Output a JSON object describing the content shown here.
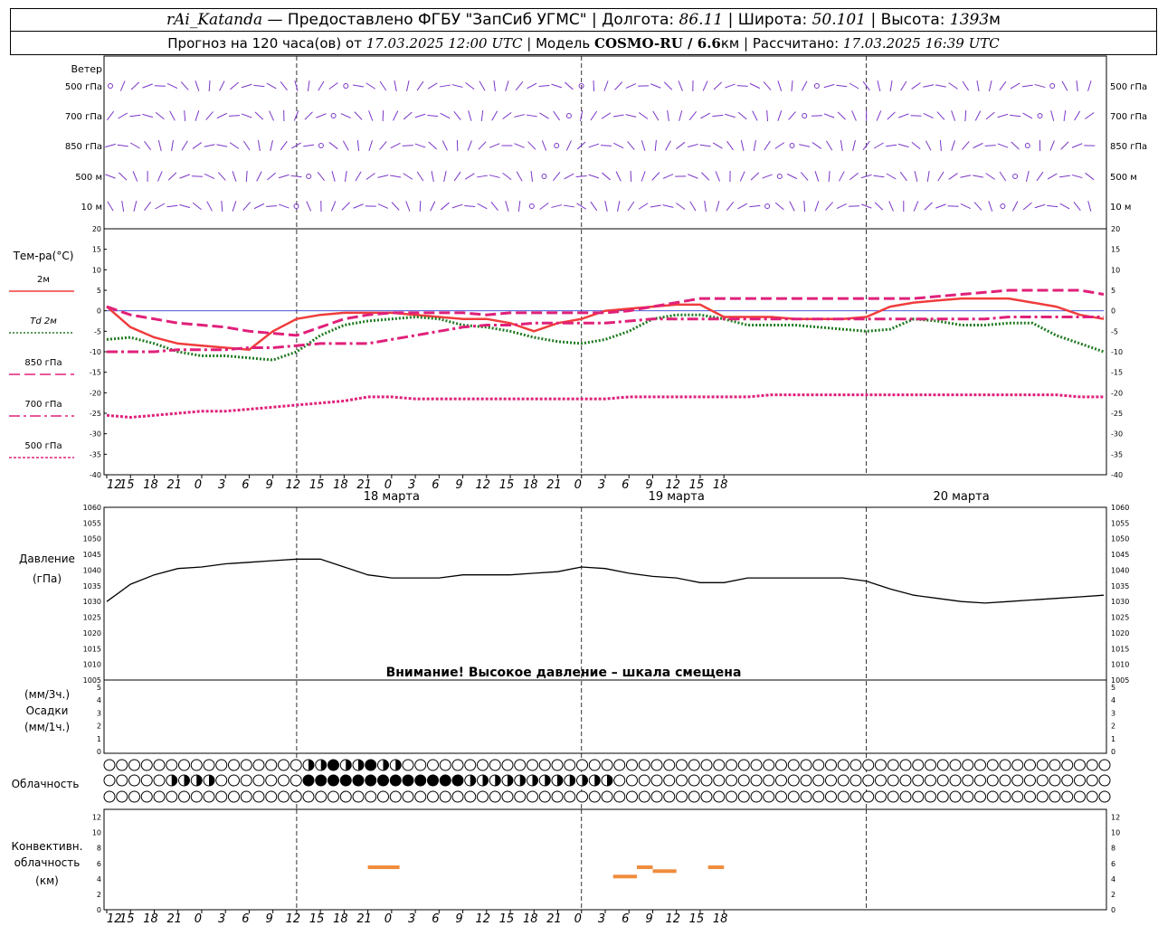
{
  "header": {
    "station": "rAi_Katanda",
    "provider": " — Предоставлено ФГБУ \"ЗапСиб УГМС\"  |  Долгота: ",
    "lon": "86.11",
    "lat_label": "  |  Широта: ",
    "lat": "50.101",
    "alt_label": "  |  Высота: ",
    "alt": "1393",
    "alt_unit": "м",
    "forecast_label": "Прогноз на 120 часа(ов) от ",
    "forecast_date": "17.03.2025 12:00 UTC",
    "model_label": "  |  Модель ",
    "model_name": "COSMO-RU / 6.6",
    "model_unit": "км",
    "calc_label": "  |  Рассчитано: ",
    "calc_date": "17.03.2025 16:39 UTC"
  },
  "wind_panel": {
    "title": "Ветер",
    "levels": [
      "500 гПа",
      "700 гПа",
      "850 гПа",
      "500 м",
      "10  м"
    ]
  },
  "temp_panel": {
    "title": "Тем-ра(°C)",
    "legend": [
      {
        "label": "2м",
        "color": "#f03c3c"
      },
      {
        "label": "Td  2м",
        "color": "#207a20"
      },
      {
        "label": "850 гПа",
        "color": "#e0207a"
      },
      {
        "label": "700 гПа",
        "color": "#e0207a"
      },
      {
        "label": "500 гПа",
        "color": "#e0207a"
      }
    ]
  },
  "pressure_panel": {
    "title_1": "Давление",
    "title_2": "(гПа)",
    "warning": "Внимание! Высокое давление – шкала смещена"
  },
  "precip_panel": {
    "label_1": "(мм/3ч.)",
    "label_2": "Осадки",
    "label_3": "(мм/1ч.)"
  },
  "cloud_panel": {
    "title": "Облачность"
  },
  "conv_panel": {
    "label_1": "Конвективн.",
    "label_2": "облачность",
    "label_3": "(км)"
  },
  "time_axis": {
    "hour_labels": [
      "12",
      "15",
      "18",
      "21",
      "0",
      "3",
      "6",
      "9",
      "12",
      "15",
      "18",
      "21",
      "0",
      "3",
      "6",
      "9",
      "12",
      "15",
      "18",
      "21",
      "0",
      "3",
      "6",
      "9",
      "12",
      "15",
      "18"
    ],
    "date_labels": [
      "18 марта",
      "19 марта",
      "20 марта"
    ]
  },
  "chart_data": [
    {
      "type": "line",
      "title": "Тем-ра(°C)",
      "x_hours": [
        0,
        3,
        6,
        9,
        12,
        15,
        18,
        21,
        24,
        27,
        30,
        33,
        36,
        39,
        42,
        45,
        48,
        51,
        54,
        57,
        60,
        63,
        66,
        69,
        72,
        75,
        78,
        81,
        84,
        87,
        90,
        93,
        96,
        99,
        102,
        105,
        108,
        111,
        114,
        117,
        120,
        123,
        126
      ],
      "ylim": [
        -40,
        20
      ],
      "series": [
        {
          "name": "2м",
          "color": "#f03c3c",
          "style": "solid",
          "values": [
            1,
            -4,
            -6.5,
            -8,
            -8.5,
            -9,
            -9.5,
            -5,
            -2,
            -1,
            -0.5,
            -0.5,
            -0.5,
            -1,
            -1.5,
            -2,
            -2,
            -3,
            -5,
            -3,
            -2,
            0,
            0.5,
            1,
            1.5,
            1.5,
            -1.5,
            -1.5,
            -1.5,
            -2,
            -2,
            -2,
            -1.5,
            1,
            2,
            2.5,
            3,
            3,
            3,
            2,
            1,
            -1,
            -2
          ]
        },
        {
          "name": "Td  2м",
          "color": "#207a20",
          "style": "dot",
          "values": [
            -7,
            -6.5,
            -8,
            -10,
            -11,
            -11,
            -11.5,
            -12,
            -10,
            -6,
            -3.5,
            -2.5,
            -2,
            -1.5,
            -2,
            -3.5,
            -4,
            -5,
            -6.5,
            -7.5,
            -8,
            -7,
            -5,
            -2,
            -1,
            -1,
            -2,
            -3.5,
            -3.5,
            -3.5,
            -4,
            -4.5,
            -5,
            -4.5,
            -2,
            -2.5,
            -3.5,
            -3.5,
            -3,
            -3,
            -6,
            -8,
            -10
          ]
        },
        {
          "name": "850 гПа",
          "color": "#e0207a",
          "style": "dash",
          "values": [
            1,
            -1,
            -2,
            -3,
            -3.5,
            -4,
            -5,
            -5.5,
            -6,
            -4,
            -2,
            -1,
            -0.5,
            -0.5,
            -0.5,
            -0.5,
            -1,
            -0.5,
            -0.5,
            -0.5,
            -0.5,
            -0.5,
            0,
            1,
            2,
            3,
            3,
            3,
            3,
            3,
            3,
            3,
            3,
            3,
            3,
            3.5,
            4,
            4.5,
            5,
            5,
            5,
            5,
            4
          ]
        },
        {
          "name": "700 гПа",
          "color": "#e0207a",
          "style": "dashdot",
          "values": [
            -10,
            -10,
            -10,
            -9.5,
            -9.5,
            -9.5,
            -9,
            -9,
            -8.5,
            -8,
            -8,
            -8,
            -7,
            -6,
            -5,
            -4,
            -3.5,
            -3.5,
            -3,
            -3,
            -3,
            -3,
            -2.5,
            -2,
            -2,
            -2,
            -2,
            -2,
            -2,
            -2,
            -2,
            -2,
            -2,
            -2,
            -2,
            -2,
            -2,
            -2,
            -1.5,
            -1.5,
            -1.5,
            -1.5,
            -1.5
          ]
        },
        {
          "name": "500 гПа",
          "color": "#e0207a",
          "style": "fine",
          "values": [
            -25.5,
            -26,
            -25.5,
            -25,
            -24.5,
            -24.5,
            -24,
            -23.5,
            -23,
            -22.5,
            -22,
            -21,
            -21,
            -21.5,
            -21.5,
            -21.5,
            -21.5,
            -21.5,
            -21.5,
            -21.5,
            -21.5,
            -21.5,
            -21,
            -21,
            -21,
            -21,
            -21,
            -21,
            -20.5,
            -20.5,
            -20.5,
            -20.5,
            -20.5,
            -20.5,
            -20.5,
            -20.5,
            -20.5,
            -20.5,
            -20.5,
            -20.5,
            -20.5,
            -21,
            -21
          ]
        }
      ]
    },
    {
      "type": "line",
      "title": "Давление",
      "ylabel": "(гПа)",
      "ylim": [
        1005,
        1060
      ],
      "x_hours": [
        0,
        3,
        6,
        9,
        12,
        15,
        18,
        21,
        24,
        27,
        30,
        33,
        36,
        39,
        42,
        45,
        48,
        51,
        54,
        57,
        60,
        63,
        66,
        69,
        72,
        75,
        78,
        81,
        84,
        87,
        90,
        93,
        96,
        99,
        102,
        105,
        108,
        111,
        114,
        117,
        120,
        123,
        126
      ],
      "values": [
        1030,
        1035.5,
        1038.5,
        1040.5,
        1041,
        1042,
        1042.5,
        1043,
        1043.5,
        1043.5,
        1041,
        1038.5,
        1037.5,
        1037.5,
        1037.5,
        1038.5,
        1038.5,
        1038.5,
        1039,
        1039.5,
        1041,
        1040.5,
        1039,
        1038,
        1037.5,
        1036,
        1036,
        1037.5,
        1037.5,
        1037.5,
        1037.5,
        1037.5,
        1036.5,
        1034,
        1032,
        1031,
        1030,
        1029.5,
        1030,
        1030.5,
        1031,
        1031.5,
        1032
      ]
    },
    {
      "type": "bar",
      "title": "Осадки",
      "ylim": [
        0,
        5
      ],
      "values": []
    },
    {
      "type": "bar",
      "title": "Конвективн. облачность (км)",
      "ylim": [
        0,
        13
      ],
      "color": "#f08c3c",
      "segments": [
        {
          "start_h": 33,
          "end_h": 37,
          "value": 5.5
        },
        {
          "start_h": 64,
          "end_h": 67,
          "value": 4.3
        },
        {
          "start_h": 67,
          "end_h": 69,
          "value": 5.5
        },
        {
          "start_h": 69,
          "end_h": 72,
          "value": 5.0
        },
        {
          "start_h": 76,
          "end_h": 78,
          "value": 5.5
        }
      ]
    }
  ]
}
